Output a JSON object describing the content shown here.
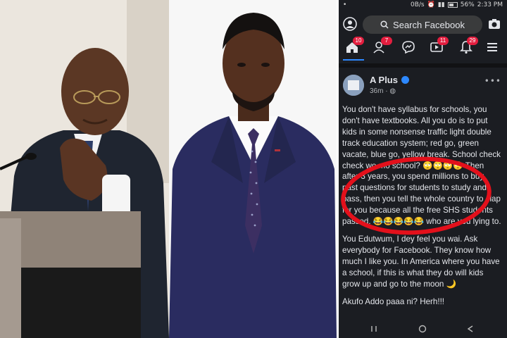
{
  "status_bar": {
    "left": "•",
    "network": "0B/s",
    "battery": "56%",
    "time": "2:33 PM"
  },
  "facebook": {
    "search_label": "Search Facebook",
    "tabs": [
      {
        "name": "home",
        "badge": "10"
      },
      {
        "name": "friends",
        "badge": "7"
      },
      {
        "name": "messenger",
        "badge": ""
      },
      {
        "name": "watch",
        "badge": "11"
      },
      {
        "name": "notifications",
        "badge": "29"
      },
      {
        "name": "menu",
        "badge": ""
      }
    ],
    "post": {
      "author": "A Plus",
      "time": "36m",
      "paragraphs": [
        "You don't have syllabus for schools, you don't have textbooks. All you do is to put kids in some nonsense traffic light double track education system; red go, green vacate, blue go, yellow break. School check check wo mo school? 🙄🙄🙄🙄 Then after 3 years, you spend millions to buy past questions for students to study and pass, then you tell the whole country to clap for you because all the free SHS students passed. 😂😂😂😂😂 who are you lying to.",
        "You Edutwum, I dey feel you wai. Ask everybody for Facebook. They know how much I like you. In America where you have a school, if this is what they do will kids grow up and go to the moon 🌙",
        "Akufo Addo paaa ni? Herh!!!"
      ]
    }
  },
  "colors": {
    "fb_dark": "#1b1d22",
    "fb_blue": "#2d88ff",
    "badge_red": "#e41e3f",
    "circle_red": "#e3101b"
  }
}
